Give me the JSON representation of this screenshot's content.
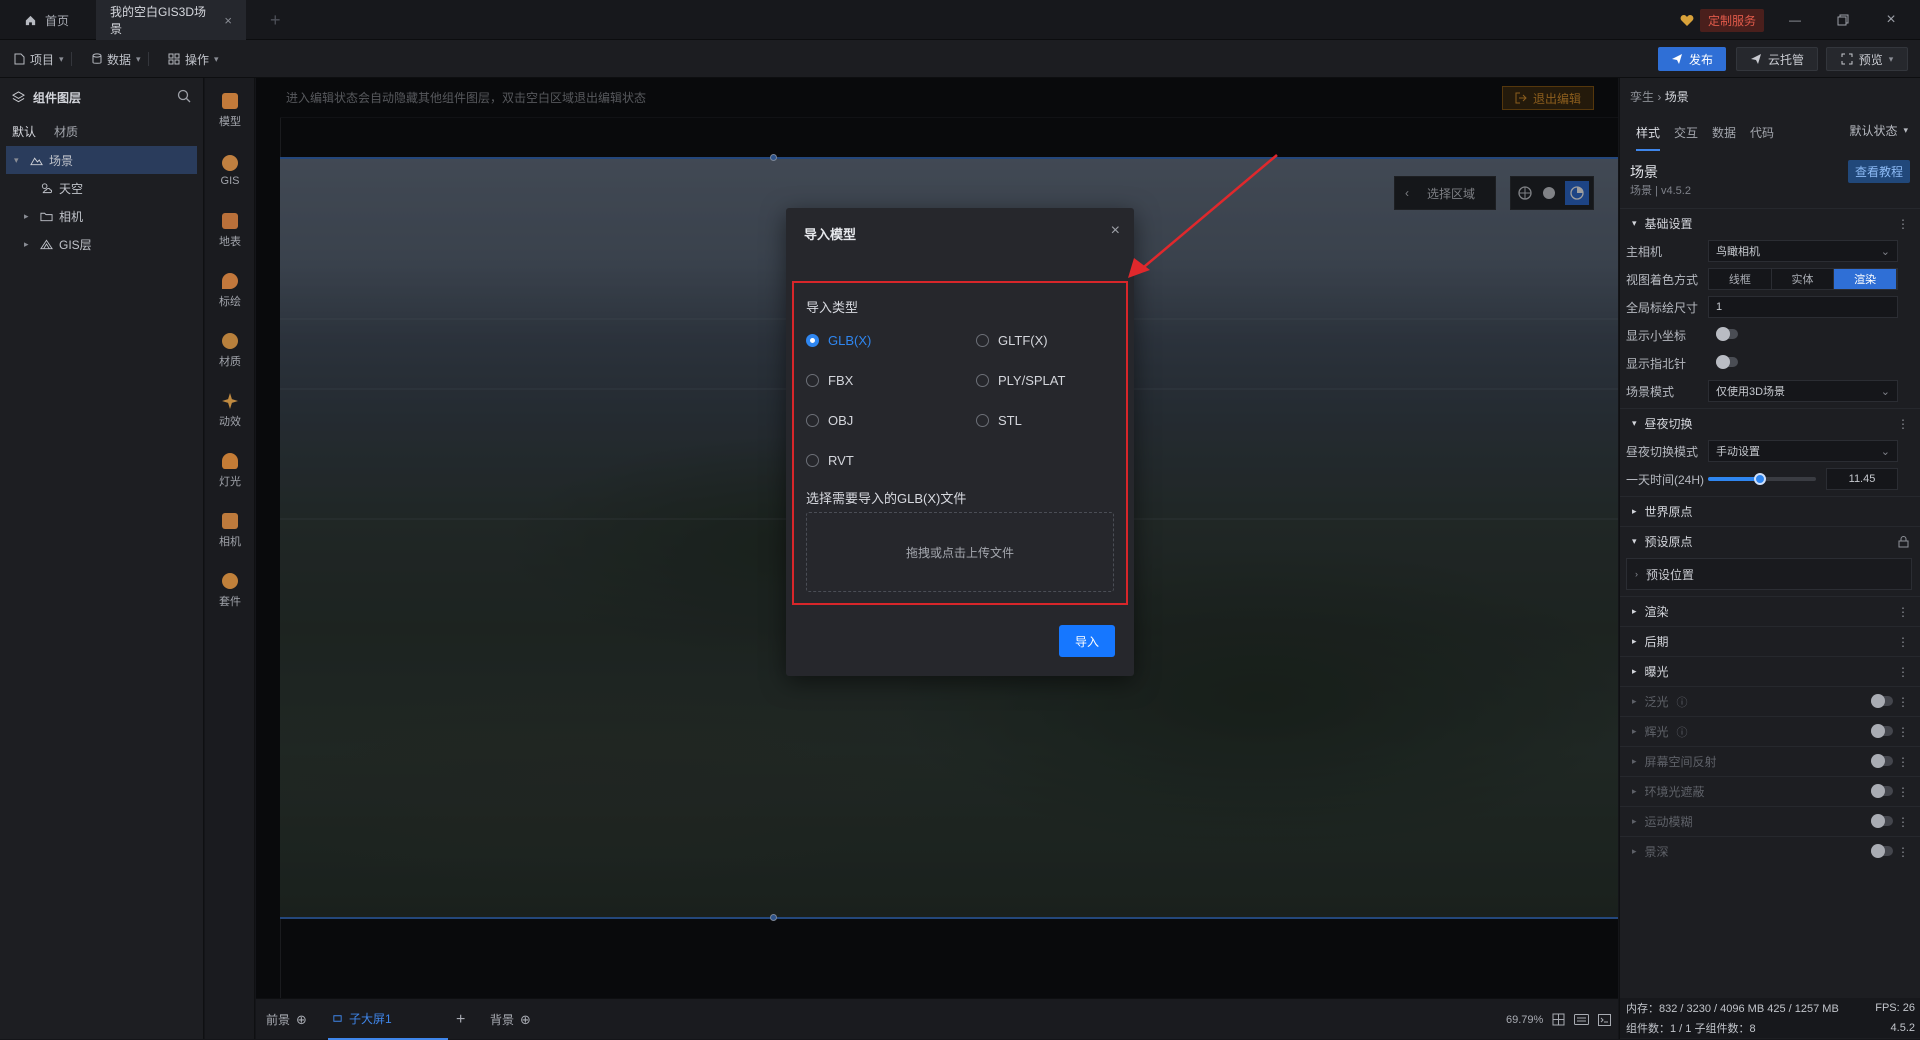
{
  "titlebar": {
    "home_tab": "首页",
    "active_tab": "我的空白GIS3D场景",
    "custom_service": "定制服务"
  },
  "menubar": {
    "project": "项目",
    "data": "数据",
    "operate": "操作",
    "publish": "发布",
    "cloud_host": "云托管",
    "preview": "预览"
  },
  "layers": {
    "title": "组件图层",
    "tab_default": "默认",
    "tab_material": "材质",
    "items": [
      {
        "label": "场景"
      },
      {
        "label": "天空"
      },
      {
        "label": "相机"
      },
      {
        "label": "GIS层"
      }
    ]
  },
  "rail": {
    "items": [
      {
        "label": "模型",
        "color": "#c27a3a"
      },
      {
        "label": "GIS",
        "color": "#c08040"
      },
      {
        "label": "地表",
        "color": "#b9703a"
      },
      {
        "label": "标绘",
        "color": "#c2783c"
      },
      {
        "label": "材质",
        "color": "#b8803c"
      },
      {
        "label": "动效",
        "color": "#c08a40"
      },
      {
        "label": "灯光",
        "color": "#c47c36"
      },
      {
        "label": "相机",
        "color": "#bd7a3c"
      },
      {
        "label": "套件",
        "color": "#c0803a"
      }
    ]
  },
  "canvas": {
    "hint": "进入编辑状态会自动隐藏其他组件图层，双击空白区域退出编辑状态",
    "exit_edit": "退出编辑",
    "select_region": "选择区域"
  },
  "modal": {
    "title": "导入模型",
    "import_type_label": "导入类型",
    "options": [
      {
        "label": "GLB(X)",
        "selected": true
      },
      {
        "label": "GLTF(X)",
        "selected": false
      },
      {
        "label": "FBX",
        "selected": false
      },
      {
        "label": "PLY/SPLAT",
        "selected": false
      },
      {
        "label": "OBJ",
        "selected": false
      },
      {
        "label": "STL",
        "selected": false
      },
      {
        "label": "RVT",
        "selected": false
      }
    ],
    "file_label": "选择需要导入的GLB(X)文件",
    "dropzone": "拖拽或点击上传文件",
    "import_button": "导入"
  },
  "bottombar": {
    "foreground": "前景",
    "screen": "子大屏1",
    "background": "背景",
    "zoom": "69.79%"
  },
  "props": {
    "crumb_parent": "孪生",
    "crumb_current": "场景",
    "tabs": [
      "样式",
      "交互",
      "数据",
      "代码"
    ],
    "state": "默认状态",
    "title": "场景",
    "subtitle": "场景 | v4.5.2",
    "tutorial": "查看教程",
    "section_basic": "基础设置",
    "main_camera_label": "主相机",
    "main_camera_value": "鸟瞰相机",
    "shading_label": "视图着色方式",
    "shading_options": [
      "线框",
      "实体",
      "渲染"
    ],
    "shading_selected": 2,
    "marker_size_label": "全局标绘尺寸",
    "marker_size_value": "1",
    "show_axis_label": "显示小坐标",
    "show_compass_label": "显示指北针",
    "scene_mode_label": "场景模式",
    "scene_mode_value": "仅使用3D场景",
    "section_daynight": "昼夜切换",
    "daynight_mode_label": "昼夜切换模式",
    "daynight_mode_value": "手动设置",
    "time_label": "一天时间(24H)",
    "time_value": "11.45",
    "time_fraction": 0.477,
    "section_world_origin": "世界原点",
    "section_preset_origin": "预设原点",
    "preset_position": "预设位置",
    "section_render": "渲染",
    "section_post": "后期",
    "section_exposure": "曝光",
    "section_bloom": "泛光",
    "section_glare": "辉光",
    "section_ssr": "屏幕空间反射",
    "section_ao": "环境光遮蔽",
    "section_motion_blur": "运动模糊",
    "section_dof": "景深",
    "memory": "内存：832 / 3230 / 4096 MB  425 / 1257 MB",
    "fps": "FPS: 26",
    "components": "组件数：1 / 1   子组件数：8",
    "version": "4.5.2"
  }
}
